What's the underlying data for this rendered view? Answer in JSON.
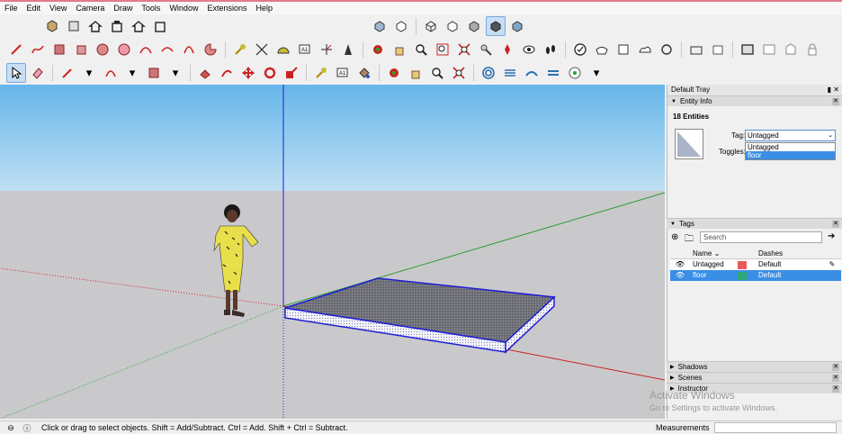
{
  "menubar": {
    "items": [
      "File",
      "Edit",
      "View",
      "Camera",
      "Draw",
      "Tools",
      "Window",
      "Extensions",
      "Help"
    ]
  },
  "toolbars": {
    "row1": [
      "iso-view-icon",
      "top-view-icon",
      "front-view-icon",
      "right-view-icon",
      "back-view-icon",
      "left-view-icon",
      "xray-style-icon",
      "back-edges-style-icon",
      "wireframe-style-icon",
      "hidden-line-style-icon",
      "shaded-style-icon",
      "shaded-texture-style-icon",
      "monochrome-style-icon"
    ],
    "row2": [
      "line-icon",
      "freehand-icon",
      "rectangle-icon",
      "rotated-rectangle-icon",
      "circle-icon",
      "polygon-icon",
      "arc-icon",
      "two-point-arc-icon",
      "three-point-arc-icon",
      "pie-icon",
      "tape-measure-icon",
      "dimension-icon",
      "protractor-icon",
      "text-icon",
      "axes-icon",
      "3d-text-icon",
      "orbit-icon",
      "pan-icon",
      "zoom-icon",
      "zoom-window-icon",
      "zoom-extents-icon",
      "position-camera-icon",
      "look-around-icon",
      "walk-icon",
      "section-plane-icon",
      "warehouse-icon",
      "extension-warehouse-icon",
      "share-model-icon",
      "sandbox-icon",
      "layout-icon",
      "photo-match-icon",
      "components-icon",
      "materials-icon",
      "styles-icon",
      "tags-icon"
    ],
    "row3": [
      "select-icon",
      "eraser-icon",
      "pencil-icon",
      "arc-tool-icon",
      "shape-icon",
      "push-pull-icon",
      "follow-me-icon",
      "move-icon",
      "rotate-icon",
      "scale-icon",
      "offset-icon",
      "tape-icon",
      "text-label-icon",
      "paint-bucket-icon",
      "orbit-tool-icon",
      "pan-tool-icon",
      "zoom-tool-icon",
      "zoom-extents-tool-icon",
      "sandbox-from-contours-icon",
      "sandbox-from-scratch-icon",
      "smoove-icon",
      "stamp-icon",
      "drape-icon",
      "geo-location-icon"
    ]
  },
  "viewport": {
    "sky_color": "#7ec3ee",
    "ground_color": "#c9c9cc",
    "blue_axis_color": "#1d1dd4",
    "green_axis_color": "#2c9b2c",
    "red_axis_color": "#cc2222",
    "floor_top_color": "#6a6a72",
    "floor_side_color": "#f4f4fa"
  },
  "tray": {
    "title": "Default Tray",
    "entity_info": {
      "header": "Entity Info",
      "count": "18 Entities",
      "tag_label": "Tag:",
      "tag_value": "Untagged",
      "toggles_label": "Toggles:",
      "dropdown_options": [
        "Untagged",
        "floor"
      ],
      "selected_option": "floor"
    },
    "tags": {
      "header": "Tags",
      "search_placeholder": "Search",
      "columns": [
        "Name",
        "Dashes"
      ],
      "rows": [
        {
          "name": "Untagged",
          "color": "#e85a5a",
          "dashes": "Default",
          "selected": false
        },
        {
          "name": "floor",
          "color": "#2eaa7a",
          "dashes": "Default",
          "selected": true
        }
      ]
    },
    "sections": [
      "Shadows",
      "Scenes",
      "Instructor"
    ]
  },
  "status": {
    "hint": "Click or drag to select objects. Shift = Add/Subtract. Ctrl = Add. Shift + Ctrl = Subtract.",
    "measurements_label": "Measurements"
  },
  "watermark": {
    "line1": "Activate Windows",
    "line2": "Go to Settings to activate Windows."
  }
}
